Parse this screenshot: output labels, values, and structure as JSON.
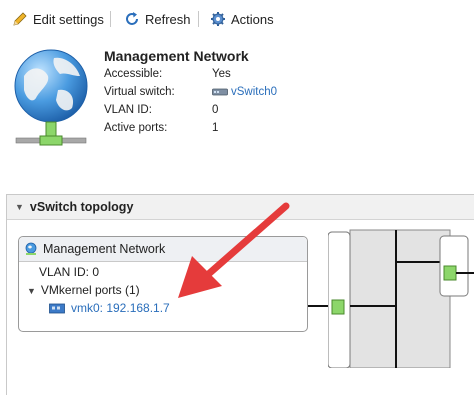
{
  "toolbar": {
    "edit_label": "Edit settings",
    "refresh_label": "Refresh",
    "actions_label": "Actions"
  },
  "network": {
    "title": "Management Network",
    "props": [
      {
        "label": "Accessible:",
        "value": "Yes"
      },
      {
        "label": "Virtual switch:",
        "value": "vSwitch0"
      },
      {
        "label": "VLAN ID:",
        "value": "0"
      },
      {
        "label": "Active ports:",
        "value": "1"
      }
    ]
  },
  "topology": {
    "header": "vSwitch topology",
    "portgroup": {
      "name": "Management Network",
      "vlan": "VLAN ID: 0",
      "vmkernel_ports": "VMkernel ports (1)",
      "vmk": "vmk0: 192.168.1.7"
    }
  },
  "colors": {
    "link": "#2a6ebb",
    "port_green": "#8cd66a",
    "arrow_red": "#e53b3b",
    "header_bg": "#f1f1f1"
  },
  "icons": [
    "pencil-icon",
    "refresh-icon",
    "gear-icon",
    "globe-icon",
    "switch-icon",
    "network-icon",
    "nic-icon",
    "arrow-annotation"
  ]
}
